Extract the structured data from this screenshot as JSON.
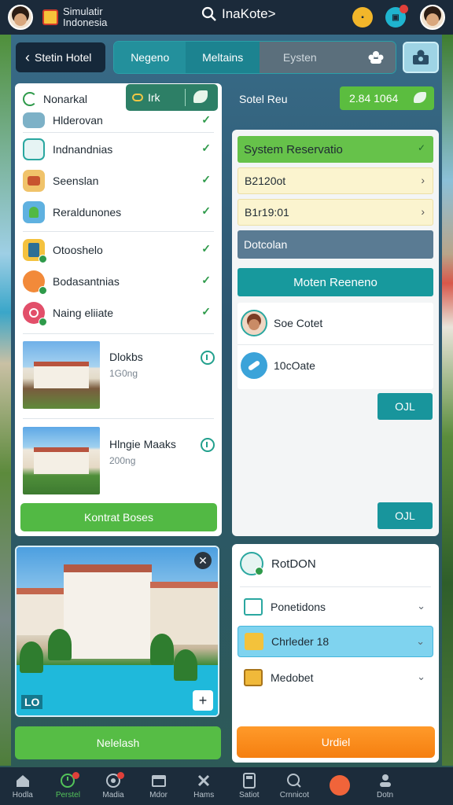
{
  "colors": {
    "topbar": "#1b2a3a",
    "accent_teal": "#17999d",
    "accent_green": "#52b944",
    "accent_orange": "#f57f10",
    "selected_row": "#7fd3ef"
  },
  "topbar": {
    "brand_line1": "Simulatir",
    "brand_line2": "Indonesia",
    "search_text": "InaKote>",
    "icon_names": [
      "search-icon",
      "notification-icon",
      "message-icon",
      "user-avatar"
    ]
  },
  "header": {
    "back_label": "Stetin Hotel",
    "tabs": [
      {
        "label": "Negeno"
      },
      {
        "label": "Meltains"
      },
      {
        "label": "Eysten"
      }
    ]
  },
  "left_panel": {
    "title": "Nonarkal",
    "link_label": "Irk",
    "items": [
      {
        "label": "Hlderovan"
      },
      {
        "label": "Indnandnias"
      },
      {
        "label": "Seenslan"
      },
      {
        "label": "Reraldunones"
      },
      {
        "label": "Otooshelo"
      },
      {
        "label": "Bodasantnias"
      },
      {
        "label": "Naing eliiate"
      }
    ],
    "hotels": [
      {
        "name": "Dlokbs",
        "sub": "1G0ng"
      },
      {
        "name": "Hlngie Maaks",
        "sub": "200ng"
      }
    ],
    "action_button": "Kontrat Boses"
  },
  "right_top": {
    "label": "Sotel Reu",
    "pill_value": "2.84 1064"
  },
  "right_panel": {
    "header": "System Reservatio",
    "rows": [
      {
        "value": "B2120ot"
      },
      {
        "value": "B1r19:01"
      }
    ],
    "slate_label": "Dotcolan",
    "teal_bar": "Moten Reeneno",
    "people": [
      {
        "label": "Soe Cotet"
      },
      {
        "label": "10cOate"
      }
    ],
    "button_1": "OJL",
    "button_2": "OJL"
  },
  "photo": {
    "tag": "LO"
  },
  "bottom_left_button": "Nelelash",
  "bottom_right": {
    "title": "RotDON",
    "rows": [
      {
        "label": "Ponetidons"
      },
      {
        "label": "Chrleder 18"
      },
      {
        "label": "Medobet"
      }
    ],
    "action_button": "Urdiel"
  },
  "bottom_nav": {
    "items": [
      {
        "label": "Hodla",
        "icon": "home-icon"
      },
      {
        "label": "Perstel",
        "icon": "clock-icon"
      },
      {
        "label": "Madia",
        "icon": "media-icon"
      },
      {
        "label": "Mdor",
        "icon": "calendar-icon"
      },
      {
        "label": "Hams",
        "icon": "tools-icon"
      },
      {
        "label": "Satiot",
        "icon": "calculator-icon"
      },
      {
        "label": "Crnnicot",
        "icon": "chat-icon"
      },
      {
        "label": "",
        "icon": "alert-icon"
      },
      {
        "label": "Dotn",
        "icon": "profile-icon"
      }
    ]
  }
}
